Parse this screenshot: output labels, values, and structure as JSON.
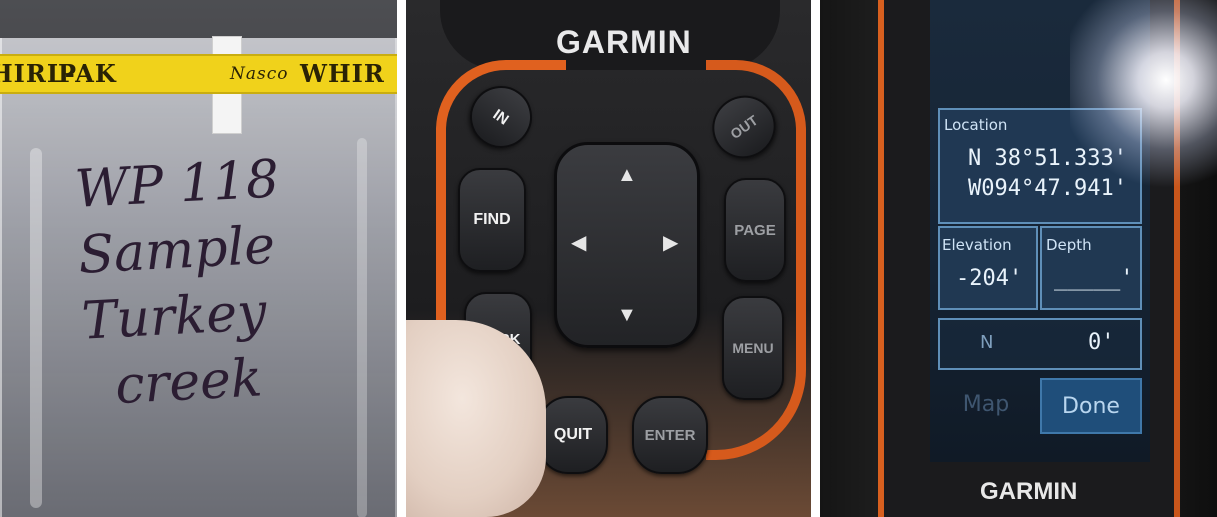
{
  "panel_bag": {
    "tape_text_1": "HIRL-",
    "tape_text_2": "PAK",
    "tape_text_3": "Nasco",
    "tape_text_4": "WHIR",
    "handwriting": [
      "WP 118",
      "Sample",
      "Turkey",
      "creek"
    ]
  },
  "panel_keypad": {
    "brand": "GARMIN",
    "keys": {
      "in": "IN",
      "out": "OUT",
      "find": "FIND",
      "page": "PAGE",
      "mark": "MARK",
      "menu": "MENU",
      "quit": "QUIT",
      "enter": "ENTER"
    },
    "arrows": {
      "up": "▲",
      "down": "▼",
      "left": "◀",
      "right": "▶"
    }
  },
  "panel_screen": {
    "location_label": "Location",
    "latitude": "N  38°51.333'",
    "longitude": "W094°47.941'",
    "elevation_label": "Elevation",
    "elevation_value": "-204'",
    "depth_label": "Depth",
    "depth_value": "_____'",
    "heading_label": "N",
    "heading_value": "0'",
    "map_button": "Map",
    "done_button": "Done",
    "brand": "GARMIN"
  },
  "colors": {
    "tape_yellow": "#f0d21b",
    "garmin_orange": "#e0611f",
    "screen_blue": "#223c58"
  }
}
